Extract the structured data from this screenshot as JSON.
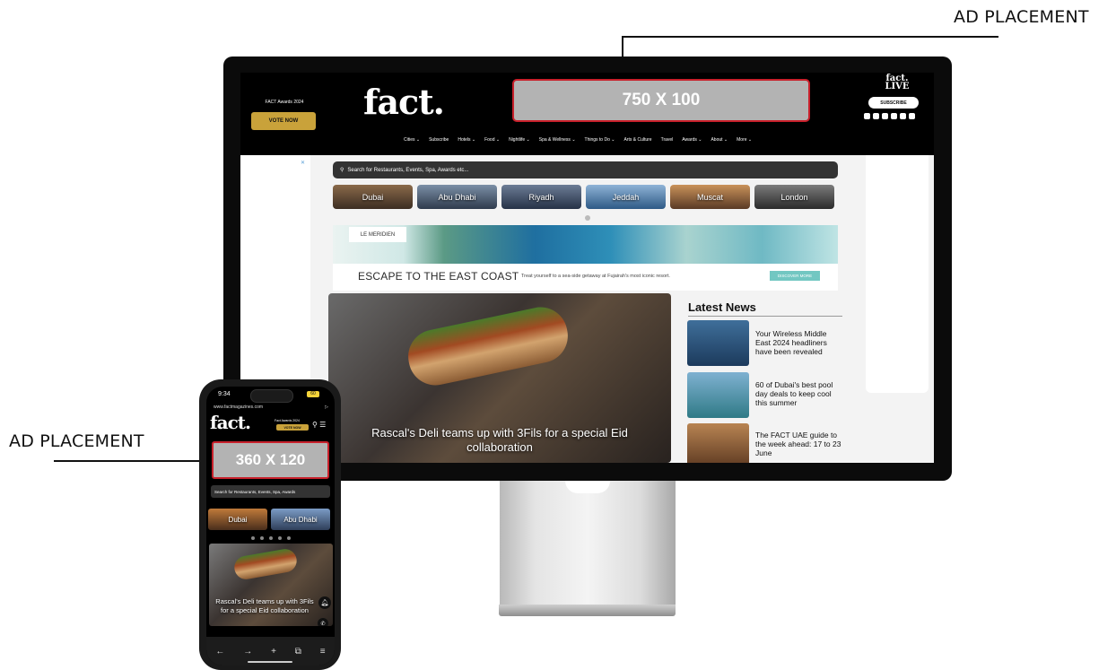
{
  "callouts": {
    "top": "AD PLACEMENT",
    "left": "AD PLACEMENT"
  },
  "desktop": {
    "header": {
      "awards_text": "FACT Awards 2024",
      "vote_label": "VOTE NOW",
      "logo": "fact.",
      "ad_size": "750 X 100",
      "live_logo_line1": "fact.",
      "live_logo_line2": "LIVE",
      "subscribe_label": "SUBSCRIBE"
    },
    "nav": [
      "Cities ⌄",
      "Subscribe",
      "Hotels ⌄",
      "Food ⌄",
      "Nightlife ⌄",
      "Spa & Wellness ⌄",
      "Things to Do ⌄",
      "Arts & Culture",
      "Travel",
      "Awards ⌄",
      "About ⌄",
      "More ⌄"
    ],
    "search_placeholder": "Search for Restaurants, Events, Spa, Awards etc...",
    "cities": [
      "Dubai",
      "Abu Dhabi",
      "Riyadh",
      "Jeddah",
      "Muscat",
      "London"
    ],
    "banner": {
      "brand": "LE MERIDIEN",
      "headline": "ESCAPE TO THE EAST COAST",
      "subline": "Treat yourself to a sea-side getaway at Fujairah's most iconic resort.",
      "cta": "DISCOVER MORE"
    },
    "hero_caption": "Rascal's Deli teams up with 3Fils for a special Eid collaboration",
    "latest": {
      "title": "Latest News",
      "items": [
        "Your Wireless Middle East 2024 headliners have been revealed",
        "60 of Dubai's best pool day deals to keep cool this summer",
        "The FACT UAE guide to the week ahead: 17 to 23 June"
      ]
    }
  },
  "phone": {
    "time": "9:34",
    "battery": "60",
    "url": "www.factmagazines.com",
    "logo": "fact.",
    "awards_text": "Fact Awards 2024",
    "vote_label": "VOTE NOW",
    "ad_size": "360 X 120",
    "search_placeholder": "Search for Restaurants, Events, Spa, Awards",
    "cities": [
      "Dubai",
      "Abu Dhabi"
    ],
    "hero_caption": "Rascal's Deli teams up with 3Fils for a special Eid collaboration"
  }
}
